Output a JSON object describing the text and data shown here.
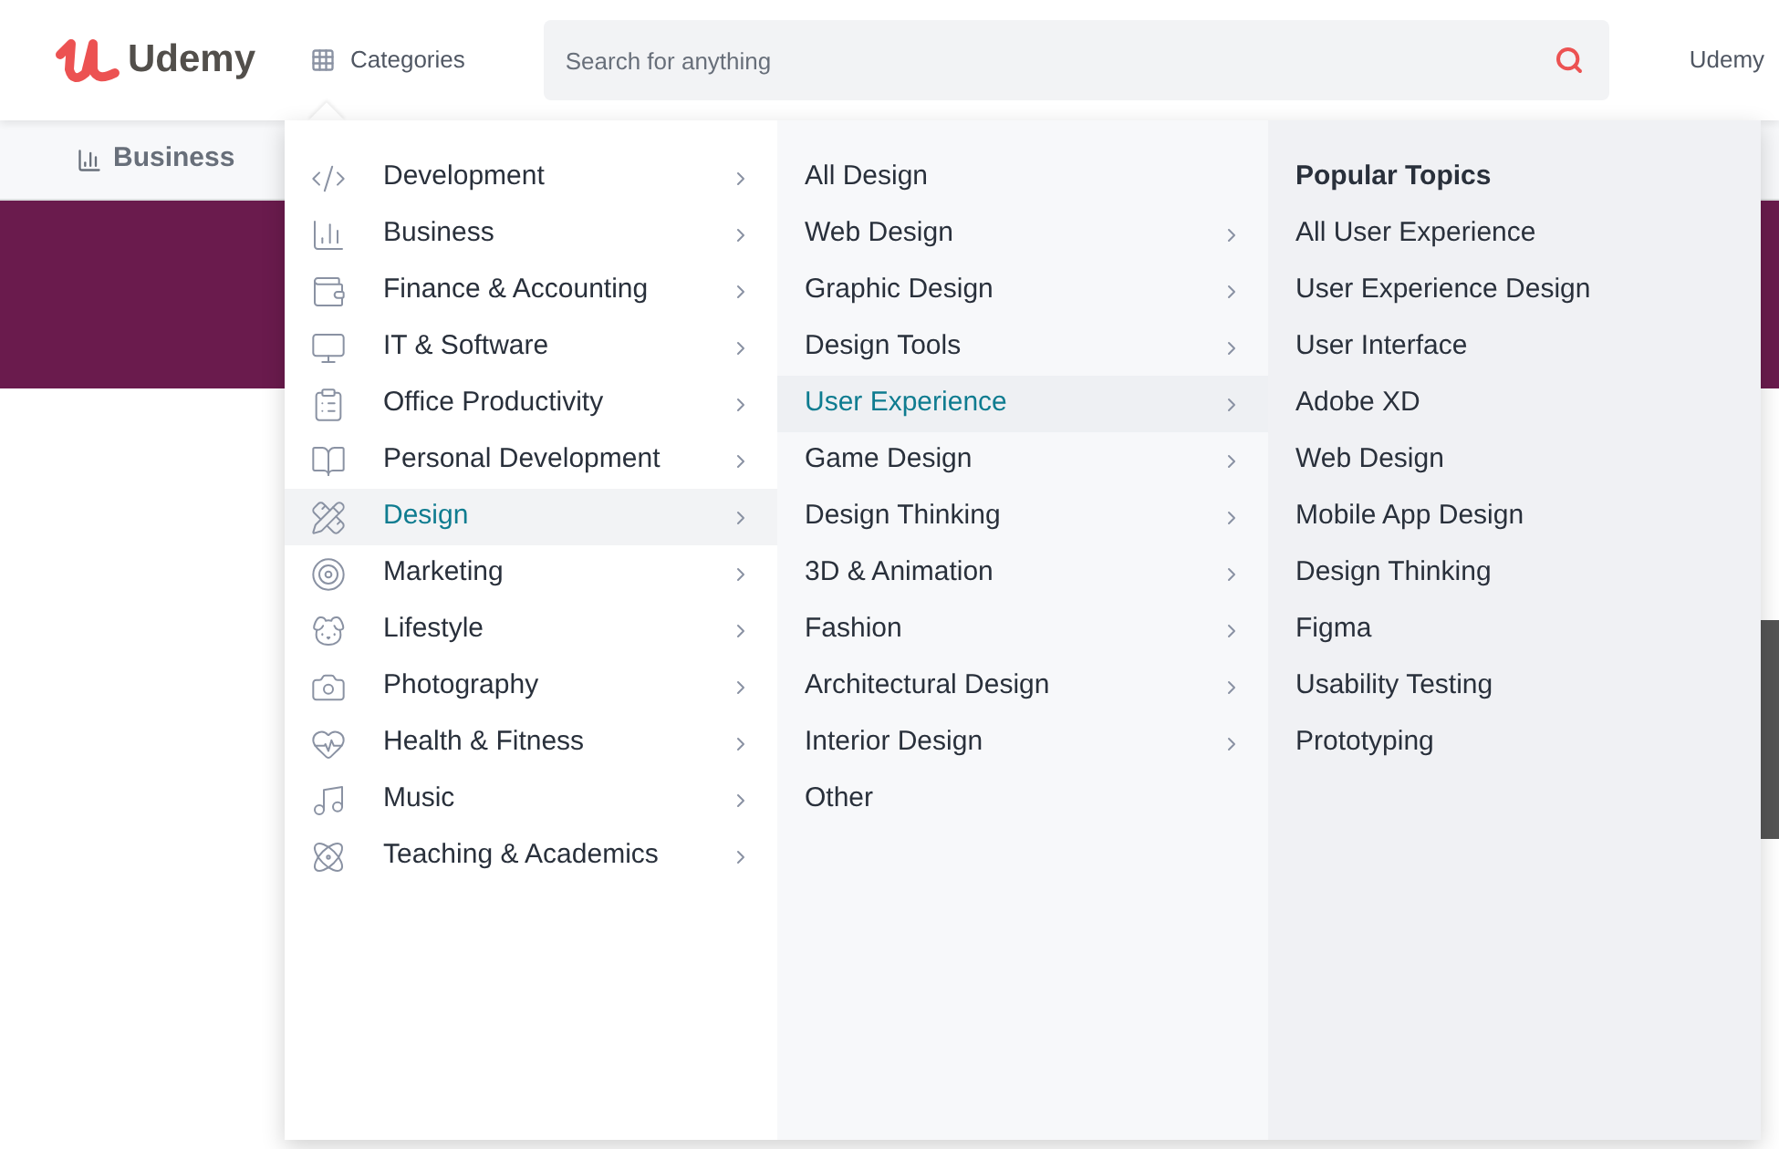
{
  "header": {
    "logo": "Udemy",
    "categories_button": "Categories",
    "search": {
      "placeholder": "Search for anything"
    },
    "nav_link": "Udemy"
  },
  "subnav": {
    "label": "Business"
  },
  "menu": {
    "categories": [
      {
        "label": "Development",
        "selected": false
      },
      {
        "label": "Business",
        "selected": false
      },
      {
        "label": "Finance & Accounting",
        "selected": false
      },
      {
        "label": "IT & Software",
        "selected": false
      },
      {
        "label": "Office Productivity",
        "selected": false
      },
      {
        "label": "Personal Development",
        "selected": false
      },
      {
        "label": "Design",
        "selected": true
      },
      {
        "label": "Marketing",
        "selected": false
      },
      {
        "label": "Lifestyle",
        "selected": false
      },
      {
        "label": "Photography",
        "selected": false
      },
      {
        "label": "Health & Fitness",
        "selected": false
      },
      {
        "label": "Music",
        "selected": false
      },
      {
        "label": "Teaching & Academics",
        "selected": false
      }
    ],
    "subcategories": [
      {
        "label": "All Design",
        "selected": false,
        "has_submenu": false
      },
      {
        "label": "Web Design",
        "selected": false,
        "has_submenu": true
      },
      {
        "label": "Graphic Design",
        "selected": false,
        "has_submenu": true
      },
      {
        "label": "Design Tools",
        "selected": false,
        "has_submenu": true
      },
      {
        "label": "User Experience",
        "selected": true,
        "has_submenu": true
      },
      {
        "label": "Game Design",
        "selected": false,
        "has_submenu": true
      },
      {
        "label": "Design Thinking",
        "selected": false,
        "has_submenu": true
      },
      {
        "label": "3D & Animation",
        "selected": false,
        "has_submenu": true
      },
      {
        "label": "Fashion",
        "selected": false,
        "has_submenu": true
      },
      {
        "label": "Architectural Design",
        "selected": false,
        "has_submenu": true
      },
      {
        "label": "Interior Design",
        "selected": false,
        "has_submenu": true
      },
      {
        "label": "Other",
        "selected": false,
        "has_submenu": false
      }
    ],
    "topics": {
      "heading": "Popular Topics",
      "items": [
        "All User Experience",
        "User Experience Design",
        "User Interface",
        "Adobe XD",
        "Web Design",
        "Mobile App Design",
        "Design Thinking",
        "Figma",
        "Usability Testing",
        "Prototyping"
      ]
    }
  }
}
